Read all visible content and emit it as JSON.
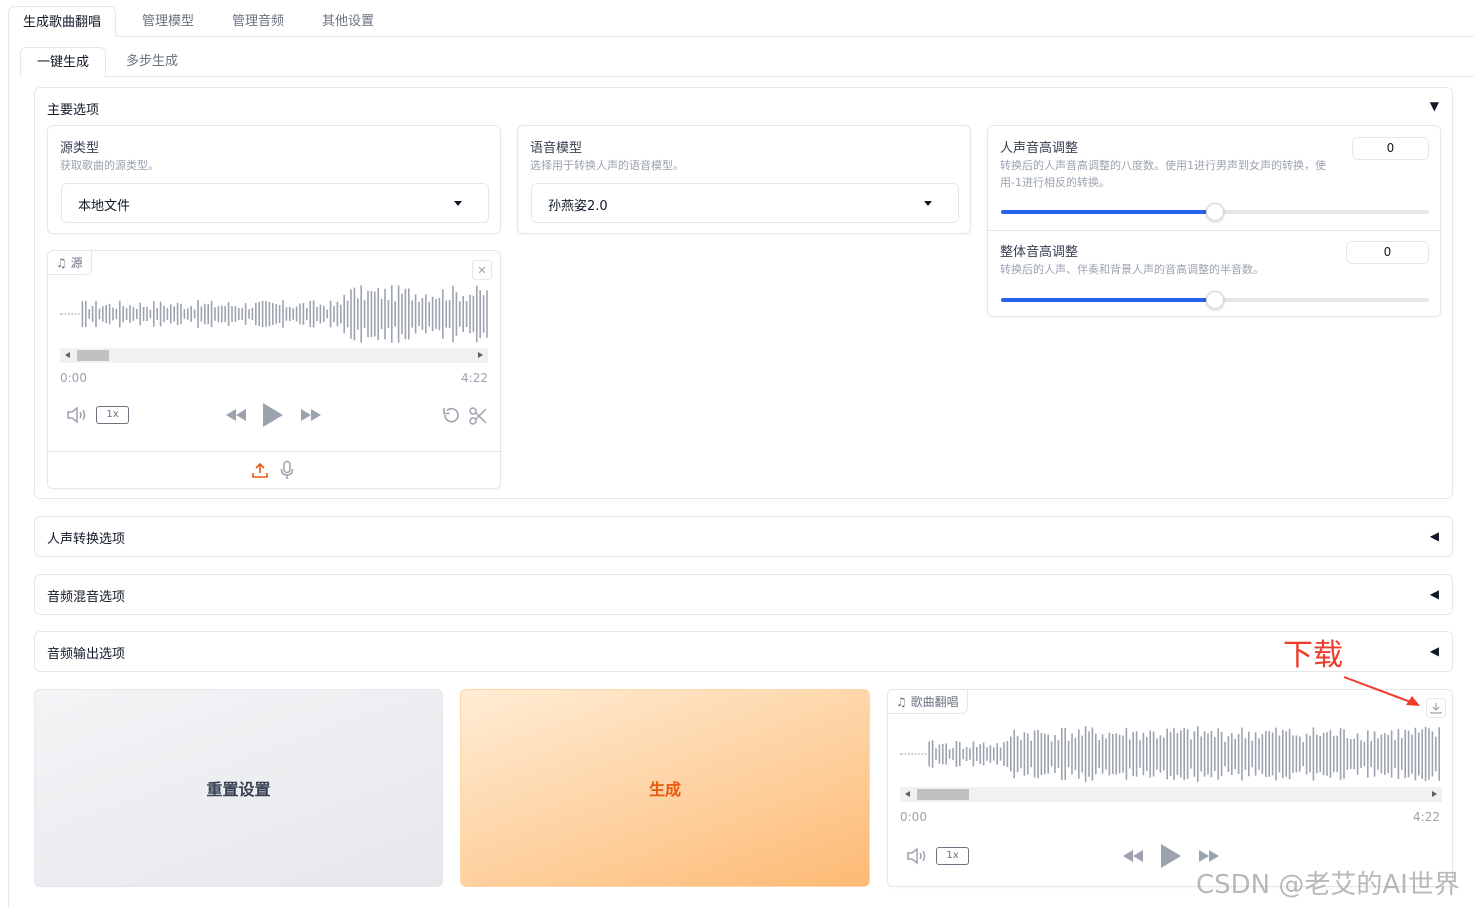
{
  "top_tabs": [
    "生成歌曲翻唱",
    "管理模型",
    "管理音频",
    "其他设置"
  ],
  "sub_tabs": [
    "一键生成",
    "多步生成"
  ],
  "main_options": {
    "title": "主要选项",
    "source_type": {
      "label": "源类型",
      "description": "获取歌曲的源类型。",
      "value": "本地文件"
    },
    "voice_model": {
      "label": "语音模型",
      "description": "选择用于转换人声的语音模型。",
      "value": "孙燕姿2.0"
    },
    "vocal_pitch": {
      "label": "人声音高调整",
      "description": "转换后的人声音高调整的八度数。使用1进行男声到女声的转换，使用-1进行相反的转换。",
      "value": "0",
      "slider_fraction": 0.5
    },
    "overall_pitch": {
      "label": "整体音高调整",
      "description": "转换后的人声、伴奏和背景人声的音高调整的半音数。",
      "value": "0",
      "slider_fraction": 0.5
    },
    "source_audio": {
      "tag": "源",
      "time_start": "0:00",
      "time_end": "4:22",
      "speed": "1x"
    }
  },
  "sections": [
    {
      "title": "人声转换选项"
    },
    {
      "title": "音频混音选项"
    },
    {
      "title": "音频输出选项"
    }
  ],
  "buttons": {
    "reset": "重置设置",
    "generate": "生成"
  },
  "output_audio": {
    "tag": "歌曲翻唱",
    "time_start": "0:00",
    "time_end": "4:22",
    "speed": "1x"
  },
  "annotation": "下载",
  "watermark": "CSDN @老艾的AI世界",
  "colors": {
    "accent_blue": "#2563eb",
    "accent_orange": "#ea580c",
    "annotation_red": "#ef3b2c"
  }
}
